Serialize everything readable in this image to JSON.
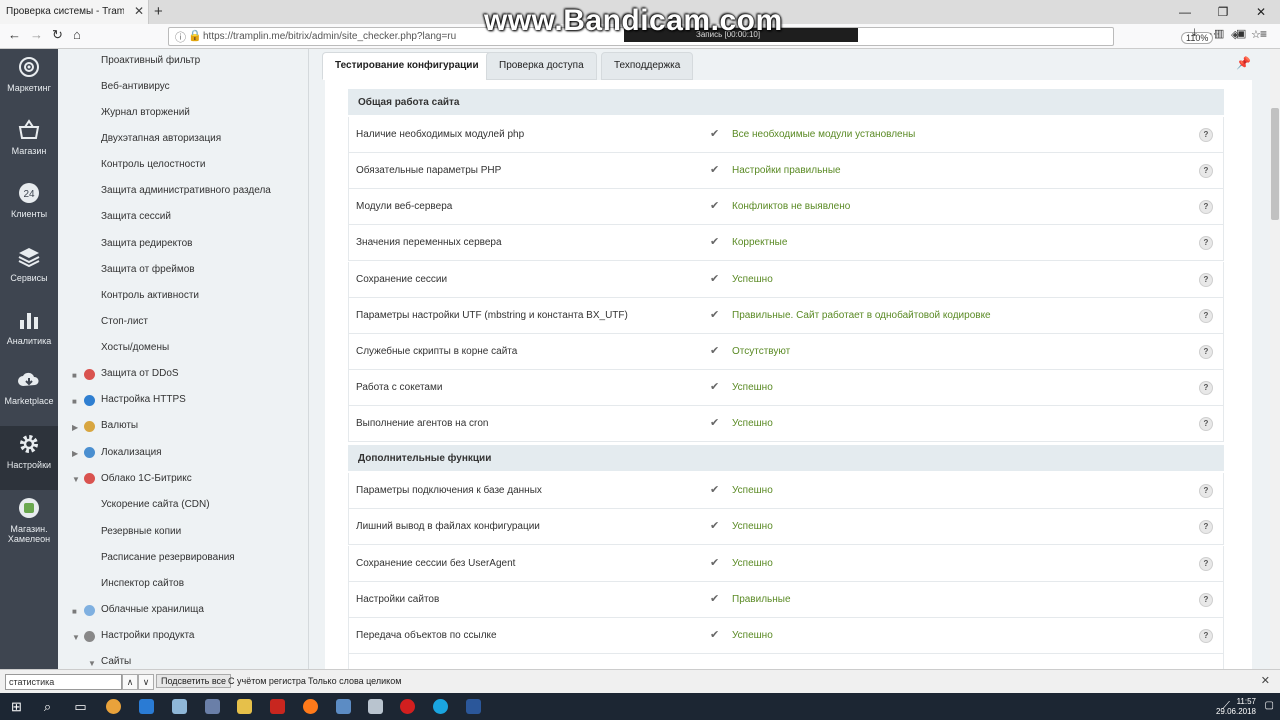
{
  "browser": {
    "tab_title": "Проверка системы - Tramplin.me",
    "tab_close": "✕",
    "new_tab": "+",
    "url": "https://tramplin.me/bitrix/admin/site_checker.php?lang=ru",
    "zoom": "110%",
    "watermark": "www.Bandicam.com",
    "recording": "Запись [00:00:10]",
    "window_controls": [
      "—",
      "❐",
      "✕"
    ]
  },
  "leftbar": {
    "items": [
      {
        "label": "Маркетинг",
        "icon": "target-icon"
      },
      {
        "label": "Магазин",
        "icon": "basket-icon"
      },
      {
        "label": "Клиенты",
        "icon": "clients-24-icon"
      },
      {
        "label": "Сервисы",
        "icon": "layers-icon"
      },
      {
        "label": "Аналитика",
        "icon": "chart-icon"
      },
      {
        "label": "Marketplace",
        "icon": "cloud-download-icon"
      },
      {
        "label": "Настройки",
        "icon": "gear-icon"
      },
      {
        "label": "Магазин. Хамелеон",
        "icon": "chameleon-icon"
      }
    ]
  },
  "menu": {
    "items": [
      {
        "label": "Проактивный фильтр",
        "level": 2
      },
      {
        "label": "Веб-антивирус",
        "level": 2
      },
      {
        "label": "Журнал вторжений",
        "level": 2
      },
      {
        "label": "Двухэтапная авторизация",
        "level": 2
      },
      {
        "label": "Контроль целостности",
        "level": 2
      },
      {
        "label": "Защита административного раздела",
        "level": 2
      },
      {
        "label": "Защита сессий",
        "level": 2
      },
      {
        "label": "Защита редиректов",
        "level": 2
      },
      {
        "label": "Защита от фреймов",
        "level": 2
      },
      {
        "label": "Контроль активности",
        "level": 2
      },
      {
        "label": "Стоп-лист",
        "level": 2
      },
      {
        "label": "Хосты/домены",
        "level": 2
      },
      {
        "label": "Защита от DDoS",
        "level": 1,
        "arrow": "■",
        "color": "#d9534f"
      },
      {
        "label": "Настройка HTTPS",
        "level": 1,
        "arrow": "■",
        "color": "#2f7fd1"
      },
      {
        "label": "Валюты",
        "level": 1,
        "arrow": "▶",
        "color": "#d8a640"
      },
      {
        "label": "Локализация",
        "level": 1,
        "arrow": "▶",
        "color": "#4a8fd0"
      },
      {
        "label": "Облако 1С-Битрикс",
        "level": 1,
        "arrow": "▼",
        "color": "#d9534f"
      },
      {
        "label": "Ускорение сайта (CDN)",
        "level": 2
      },
      {
        "label": "Резервные копии",
        "level": 2
      },
      {
        "label": "Расписание резервирования",
        "level": 2
      },
      {
        "label": "Инспектор сайтов",
        "level": 2
      },
      {
        "label": "Облачные хранилища",
        "level": 1,
        "arrow": "■",
        "color": "#7fb0e0"
      },
      {
        "label": "Настройки продукта",
        "level": 1,
        "arrow": "▼",
        "color": "#888888"
      },
      {
        "label": "Сайты",
        "level": 2,
        "arrow": "▼"
      }
    ]
  },
  "tabs": [
    "Тестирование конфигурации",
    "Проверка доступа",
    "Техподдержка"
  ],
  "sections": [
    {
      "title": "Общая работа сайта",
      "rows": [
        {
          "name": "Наличие необходимых модулей php",
          "result": "Все необходимые модули установлены"
        },
        {
          "name": "Обязательные параметры PHP",
          "result": "Настройки правильные"
        },
        {
          "name": "Модули веб-сервера",
          "result": "Конфликтов не выявлено"
        },
        {
          "name": "Значения переменных сервера",
          "result": "Корректные"
        },
        {
          "name": "Сохранение сессии",
          "result": "Успешно"
        },
        {
          "name": "Параметры настройки UTF (mbstring и константа BX_UTF)",
          "result": "Правильные. Сайт работает в однобайтовой кодировке"
        },
        {
          "name": "Служебные скрипты в корне сайта",
          "result": "Отсутствуют"
        },
        {
          "name": "Работа с сокетами",
          "result": "Успешно"
        },
        {
          "name": "Выполнение агентов на cron",
          "result": "Успешно"
        }
      ]
    },
    {
      "title": "Дополнительные функции",
      "rows": [
        {
          "name": "Параметры подключения к базе данных",
          "result": "Успешно"
        },
        {
          "name": "Лишний вывод в файлах конфигурации",
          "result": "Успешно"
        },
        {
          "name": "Сохранение сессии без UserAgent",
          "result": "Успешно"
        },
        {
          "name": "Настройки сайтов",
          "result": "Правильные"
        },
        {
          "name": "Передача объектов по ссылке",
          "result": "Успешно"
        }
      ]
    }
  ],
  "check_mark": "✔",
  "help_mark": "?",
  "findbar": {
    "value": "статистика",
    "highlight_all": "Подсветить все",
    "match_case": "С учётом регистра",
    "whole_words": "Только слова целиком"
  },
  "taskbar": {
    "time": "11:57",
    "date": "29.06.2018"
  },
  "colors": {
    "accent_green": "#5a8a24",
    "sidebar_dark": "#3e4550",
    "menu_bg": "#eef2f4"
  }
}
